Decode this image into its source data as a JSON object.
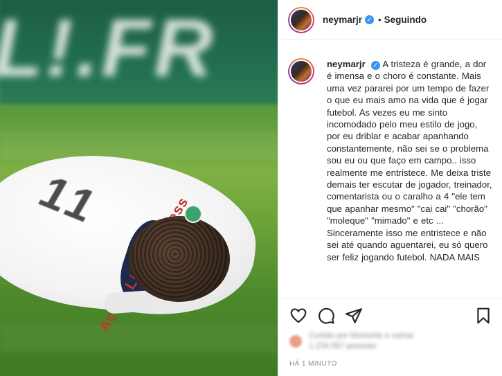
{
  "post": {
    "username": "neymarjr",
    "follow_status": "Seguindo",
    "separator": "•",
    "verified_symbol": "✓",
    "caption": "A tristeza é grande, a dor é imensa e o choro é constante. Mais uma vez pararei por um tempo de fazer o que eu mais amo na vida que é jogar futebol. As vezes eu me sinto incomodado pelo meu estilo de jogo, por eu driblar e acabar apanhando constantemente, não sei se o problema sou eu ou que faço em campo.. isso realmente me entristece. Me deixa triste demais ter escutar de jogador, treinador, comentarista ou o caralho a 4 \"ele tem que apanhar mesmo\" \"cai cai\" \"chorão\" \"moleque\" \"mimado\" e etc ...\nSinceramente isso me entristece e não sei até quando aguentarei, eu só quero ser feliz jogando futebol. NADA MAIS",
    "liked_by_text": "Curtido por blsmonte e outras 1.234.567 pessoas",
    "timestamp": "HÁ 1 MINUTO",
    "icons": [
      "heart-icon",
      "comment-icon",
      "share-icon",
      "bookmark-icon"
    ]
  },
  "photo": {
    "board_text": "L!.FR",
    "shirt_number": "11",
    "sponsor_text": "Accor Live Limitless"
  },
  "colors": {
    "verified_blue": "#3897f0",
    "text_primary": "#262626",
    "text_secondary": "#8e8e8e",
    "border": "#efefef"
  }
}
